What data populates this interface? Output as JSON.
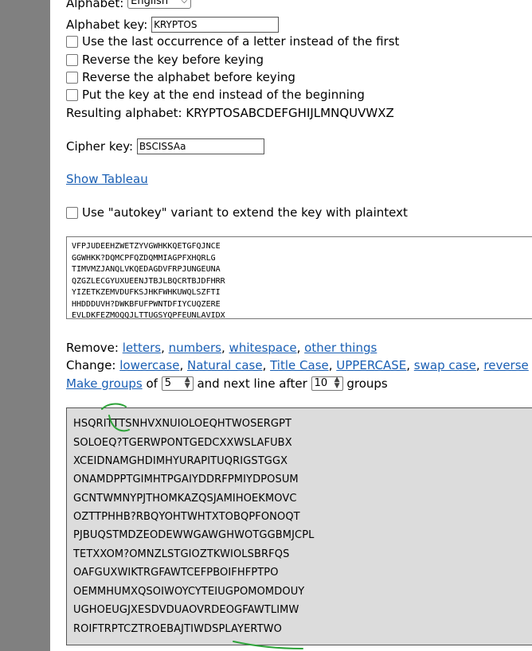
{
  "alphabet": {
    "label": "Alphabet:",
    "selected": "English"
  },
  "alphabet_key": {
    "label": "Alphabet key:",
    "value": "KRYPTOS"
  },
  "options": [
    {
      "label": "Use the last occurrence of a letter instead of the first"
    },
    {
      "label": "Reverse the key before keying"
    },
    {
      "label": "Reverse the alphabet before keying"
    },
    {
      "label": "Put the key at the end instead of the beginning"
    }
  ],
  "resulting_alphabet": {
    "label": "Resulting alphabet:",
    "value": "KRYPTOSABCDEFGHIJLMNQUVWXZ"
  },
  "cipher_key": {
    "label": "Cipher key:",
    "value": "BSCISSAa"
  },
  "show_tableau": "Show Tableau",
  "autokey": {
    "label": "Use \"autokey\" variant to extend the key with plaintext"
  },
  "input_lines": [
    "VFPJUDEEHZWETZYVGWHKKQETGFQJNCE",
    "GGWHKK?DQMCPFQZDQMMIAGPFXHQRLG",
    "TIMVMZJANQLVKQEDAGDVFRPJUNGEUNA",
    "QZGZLECGYUXUEENJTBJLBQCRTBJDFHRR",
    "YIZETKZEMVDUFKSJHKFWHKUWQLSZFTI",
    "HHDDDUVH?DWKBFUFPWNTDFIYCUQZERE",
    "EVLDKFEZMOQQJLTTUGSYQPFEUNLAVIDX"
  ],
  "remove": {
    "label": "Remove:",
    "links": [
      "letters",
      "numbers",
      "whitespace",
      "other things"
    ]
  },
  "change": {
    "label": "Change:",
    "links": [
      "lowercase",
      "Natural case",
      "Title Case",
      "UPPERCASE",
      "swap case",
      "reverse"
    ]
  },
  "groups": {
    "link": "Make groups",
    "of_text": "of",
    "group_size": "5",
    "after_text": "and next line after",
    "line_groups": "10",
    "groups_text": "groups"
  },
  "output_lines": [
    "HSQRITTTSNHVXNUIOLOEQHTWOSERGPT",
    "SOLOEQ?TGERWPONTGEDCXXWSLAFUBX",
    "XCEIDNAMGHDIMHYURAPITUQRIGSTGGX",
    "ONAMDPPTGIMHTPGAIYDDRFPMIYDPOSUM",
    "GCNTWMNYPJTHOMKAZQSJAMIHOEKMOVC",
    "OZTTPHHB?RBQYOHTWHTXTOBQPFONOQT",
    "PJBUQSTMDZEODEWWGAWGHWOTGGBMJCPL",
    "TETXXOM?OMNZLSTGIOZTKWIOLSBRFQS",
    "OAFGUXWIKTRGFAWTCEFPBOIFHFPTPO",
    "OEMMHUMXQSOIWOYCYTEIUGPOMOMDOUY",
    "UGHOEUGJXESDVDUAOVRDEOGFAWTLIMW",
    "ROIFTRPTCZTROEBAJTIWDSPLAYERTWO"
  ],
  "colors": {
    "link": "#1a5fb4",
    "annotation": "#2ea33a",
    "output_bg": "#dcdcdc",
    "sidebar": "#808080"
  }
}
